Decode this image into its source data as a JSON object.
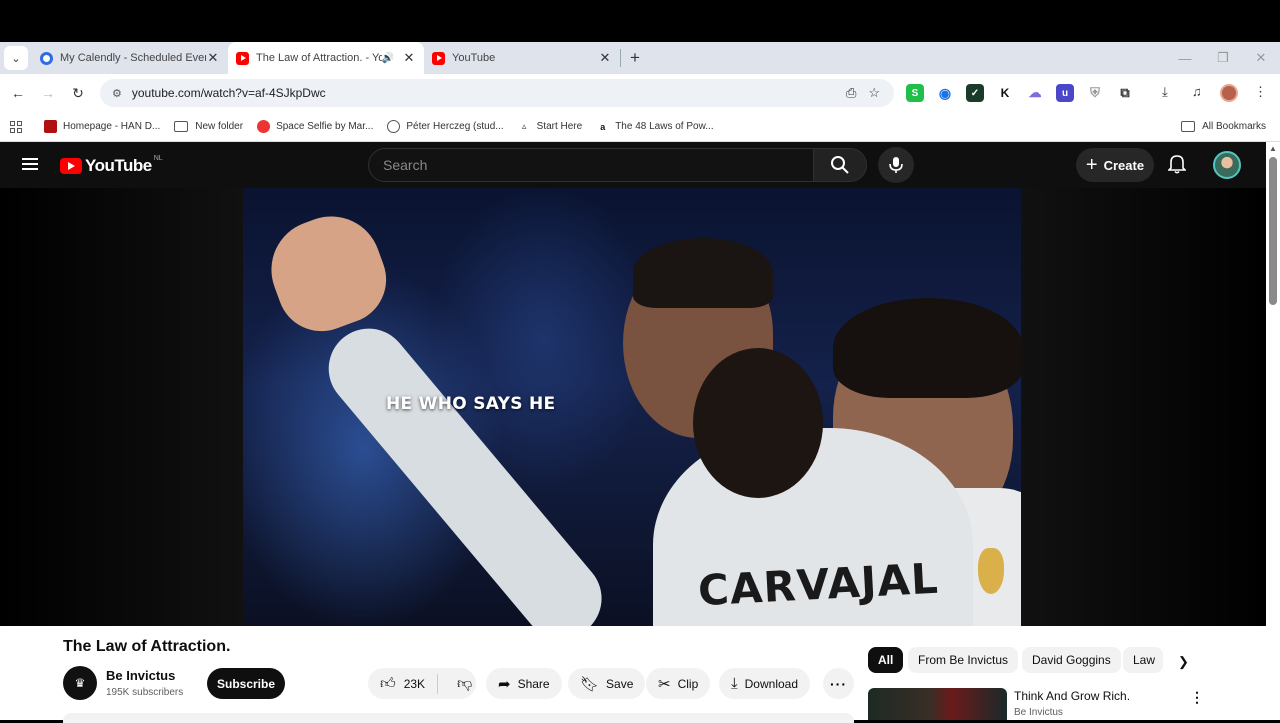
{
  "browser": {
    "tabs": [
      {
        "title": "My Calendly - Scheduled Events",
        "close": "✕"
      },
      {
        "title": "The Law of Attraction. - YouTube",
        "close": "✕",
        "audio": "🔊"
      },
      {
        "title": "YouTube",
        "close": "✕"
      }
    ],
    "new_tab": "+",
    "url": "youtube.com/watch?v=af-4SJkpDwc",
    "bookmarks": [
      {
        "label": "Homepage - HAN D..."
      },
      {
        "label": "New folder"
      },
      {
        "label": "Space Selfie by Mar..."
      },
      {
        "label": "Péter Herczeg (stud..."
      },
      {
        "label": "Start Here"
      },
      {
        "label": "The 48 Laws of Pow..."
      }
    ],
    "all_bookmarks": "All Bookmarks",
    "extensions": [
      "S",
      "◉",
      "✓",
      "K",
      "☁",
      "u",
      "⛨"
    ]
  },
  "youtube": {
    "logo_text": "YouTube",
    "country_code": "NL",
    "search_placeholder": "Search",
    "create_label": "Create",
    "video": {
      "caption": "HE WHO SAYS HE",
      "jersey_text": "CARVAJAL",
      "title": "The Law of Attraction.",
      "channel": "Be Invictus",
      "subscribers": "195K subscribers",
      "subscribe_label": "Subscribe",
      "likes": "23K",
      "share_label": "Share",
      "save_label": "Save",
      "clip_label": "Clip",
      "download_label": "Download"
    },
    "chips": [
      "All",
      "From Be Invictus",
      "David Goggins",
      "Law"
    ],
    "recommendation": {
      "title": "Think And Grow Rich.",
      "channel": "Be Invictus"
    }
  },
  "colors": {
    "youtube_red": "#ff0000",
    "tab_strip": "#dfe3eb",
    "yt_dark": "#0f0f0f"
  }
}
